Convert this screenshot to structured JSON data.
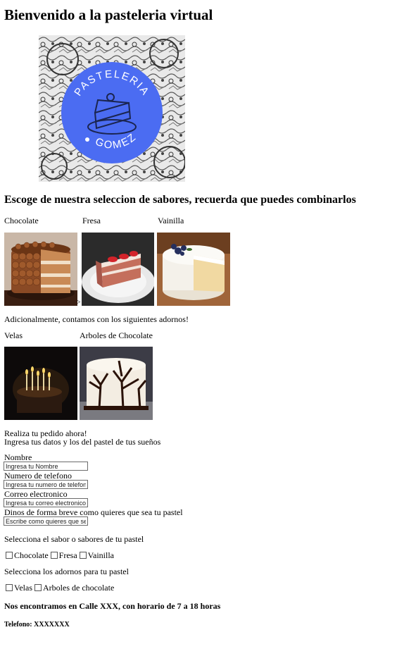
{
  "header": {
    "title": "Bienvenido a la pasteleria virtual"
  },
  "logo": {
    "line1": "PASTELERIA",
    "line2": "GOMEZ"
  },
  "flavors": {
    "heading": "Escoge de nuestra seleccion de sabores, recuerda que puedes combinarlos",
    "items": [
      {
        "label": "Chocolate"
      },
      {
        "label": "Fresa"
      },
      {
        "label": "Vainilla"
      }
    ],
    "stray_text": ">"
  },
  "decorations": {
    "intro": "Adicionalmente, contamos con los siguientes adornos!",
    "items": [
      {
        "label": "Velas"
      },
      {
        "label": "Arboles de Chocolate"
      }
    ]
  },
  "order": {
    "line1": "Realiza tu pedido ahora!",
    "line2": "Ingresa tus datos y los del pastel de tus sueños",
    "fields": [
      {
        "label": "Nombre",
        "placeholder": "Ingresa tu Nombre"
      },
      {
        "label": "Numero de telefono",
        "placeholder": "Ingresa tu numero de telefono"
      },
      {
        "label": "Correo electronico",
        "placeholder": "Ingresa tu correo electronico"
      },
      {
        "label": "Dinos de forma breve como quieres que sea tu pastel",
        "placeholder": "Escribe como quieres que sea"
      }
    ],
    "flavor_prompt": "Selecciona el sabor o sabores de tu pastel",
    "flavor_options": [
      "Chocolate",
      "Fresa",
      "Vainilla"
    ],
    "decor_prompt": "Selecciona los adornos para tu pastel",
    "decor_options": [
      "Velas",
      "Arboles de chocolate"
    ]
  },
  "footer": {
    "address": "Nos encontramos en Calle XXX, con horario de 7 a 18 horas",
    "phone": "Telefono: XXXXXXX"
  },
  "colors": {
    "logo_blue": "#4b6cf2",
    "text": "#000000"
  }
}
